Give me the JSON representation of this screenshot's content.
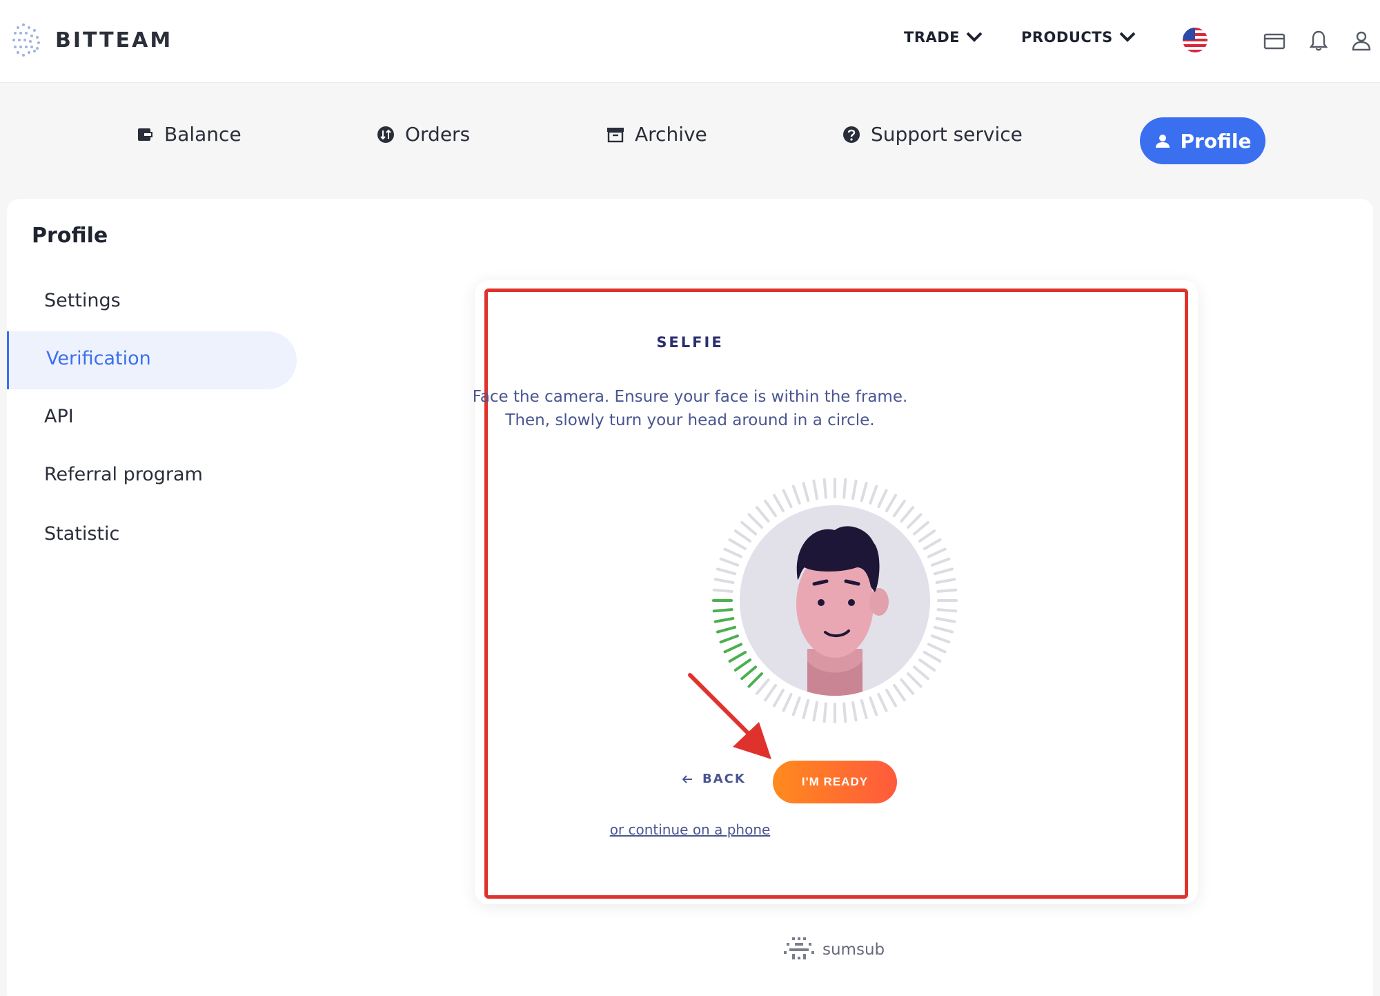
{
  "header": {
    "logo_text": "BITTEAM",
    "nav": [
      {
        "label": "TRADE"
      },
      {
        "label": "PRODUCTS"
      }
    ],
    "icons": [
      "us-flag-icon",
      "wallet-icon",
      "bell-icon",
      "user-icon"
    ]
  },
  "tabs": [
    {
      "label": "Balance",
      "icon": "wallet-icon"
    },
    {
      "label": "Orders",
      "icon": "orders-icon"
    },
    {
      "label": "Archive",
      "icon": "archive-icon"
    },
    {
      "label": "Support service",
      "icon": "help-icon"
    },
    {
      "label": "Profile",
      "icon": "person-icon",
      "active": true
    }
  ],
  "sidebar": {
    "title": "Profile",
    "items": [
      {
        "label": "Settings"
      },
      {
        "label": "Verification",
        "active": true
      },
      {
        "label": "API"
      },
      {
        "label": "Referral program"
      },
      {
        "label": "Statistic"
      }
    ]
  },
  "selfie": {
    "title": "SELFIE",
    "desc_line1": "Face the camera. Ensure your face is within the frame.",
    "desc_line2": "Then, slowly turn your head around in a circle.",
    "back_label": "BACK",
    "ready_label": "I'M READY",
    "phone_link": "or continue on a phone",
    "progress_fraction": 0.13
  },
  "footer": {
    "brand": "sumsub"
  },
  "colors": {
    "accent": "#3a6ff0",
    "highlight_border": "#e0322c",
    "button_start": "#ff8a1e",
    "button_end": "#ff5a3c",
    "progress_green": "#4caf50"
  }
}
